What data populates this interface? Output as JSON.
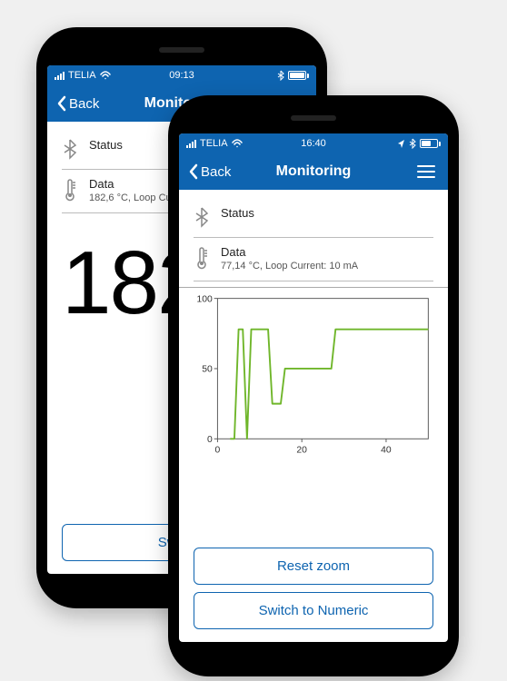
{
  "left_phone": {
    "statusbar": {
      "carrier": "TELIA",
      "time": "09:13"
    },
    "navbar": {
      "back": "Back",
      "title": "Monitoring"
    },
    "status_label": "Status",
    "data_label": "Data",
    "data_value": "182,6 °C, Loop Cur",
    "big_number": "182",
    "switch_button": "Switch t"
  },
  "right_phone": {
    "statusbar": {
      "carrier": "TELIA",
      "time": "16:40"
    },
    "navbar": {
      "back": "Back",
      "title": "Monitoring"
    },
    "status_label": "Status",
    "data_label": "Data",
    "data_value": "77,14 °C, Loop Current: 10 mA",
    "reset_button": "Reset zoom",
    "switch_button": "Switch to Numeric"
  },
  "chart_data": {
    "type": "line",
    "xlabel": "",
    "ylabel": "",
    "xlim": [
      0,
      50
    ],
    "ylim": [
      0,
      100
    ],
    "x_ticks": [
      0,
      20,
      40
    ],
    "y_ticks": [
      0,
      50,
      100
    ],
    "series": [
      {
        "name": "temperature",
        "color": "#6fb62a",
        "x": [
          3,
          4,
          5,
          6,
          7,
          8,
          12,
          13,
          15,
          16,
          22,
          23,
          27,
          28,
          50
        ],
        "y": [
          0,
          0,
          78,
          78,
          0,
          78,
          78,
          25,
          25,
          50,
          50,
          50,
          50,
          78,
          78
        ]
      }
    ]
  }
}
